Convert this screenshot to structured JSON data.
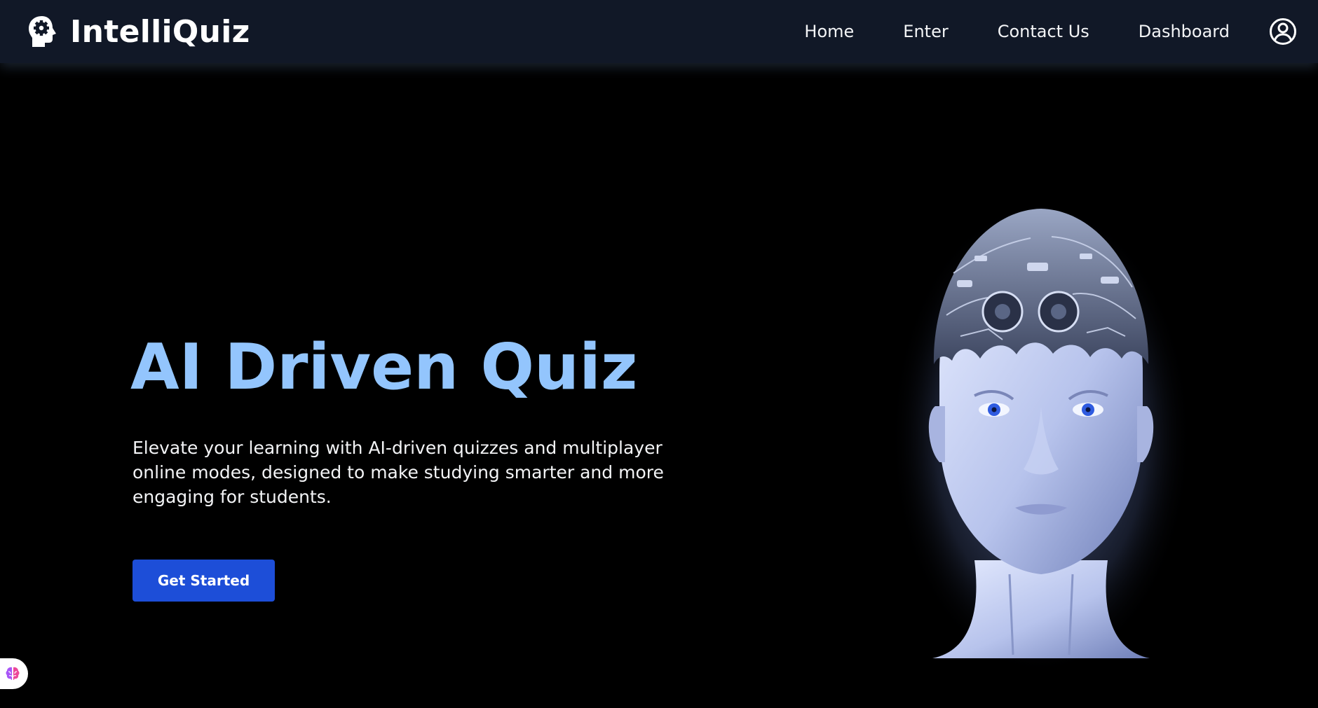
{
  "brand": {
    "name": "IntelliQuiz",
    "icon": "head-gear-icon"
  },
  "nav": {
    "items": [
      {
        "label": "Home"
      },
      {
        "label": "Enter"
      },
      {
        "label": "Contact Us"
      },
      {
        "label": "Dashboard"
      }
    ],
    "user_icon": "user-circle-icon"
  },
  "hero": {
    "title": "AI Driven Quiz",
    "description": "Elevate your learning with AI-driven quizzes and multiplayer online modes, designed to make studying smarter and more engaging for students.",
    "cta_label": "Get Started",
    "image": "robotic-head-illustration"
  },
  "widget": {
    "icon": "brain-icon"
  },
  "colors": {
    "navbar_bg": "#111827",
    "page_bg": "#000000",
    "title": "#93c5fd",
    "cta": "#1d4ed8"
  }
}
